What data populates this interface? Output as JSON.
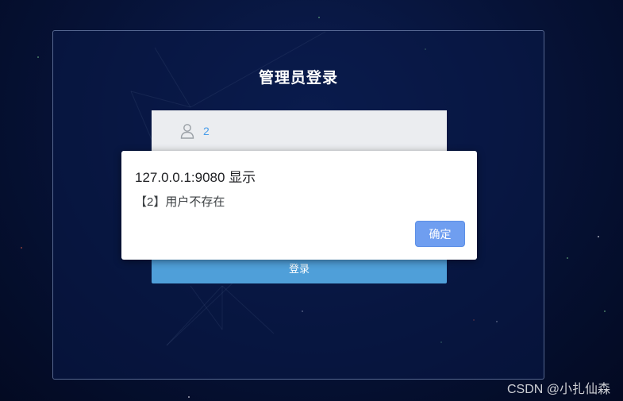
{
  "login": {
    "title": "管理员登录",
    "username_value": "2",
    "login_button": "登录"
  },
  "alert": {
    "title": "127.0.0.1:9080 显示",
    "message": "【2】用户不存在",
    "ok_button": "确定"
  },
  "watermark": "CSDN @小扎仙森",
  "icons": {
    "user": "user-icon"
  },
  "colors": {
    "background": "#061236",
    "login_button": "#4f9fd9",
    "ok_button": "#6f9ef0",
    "username_text": "#4a9eea"
  }
}
